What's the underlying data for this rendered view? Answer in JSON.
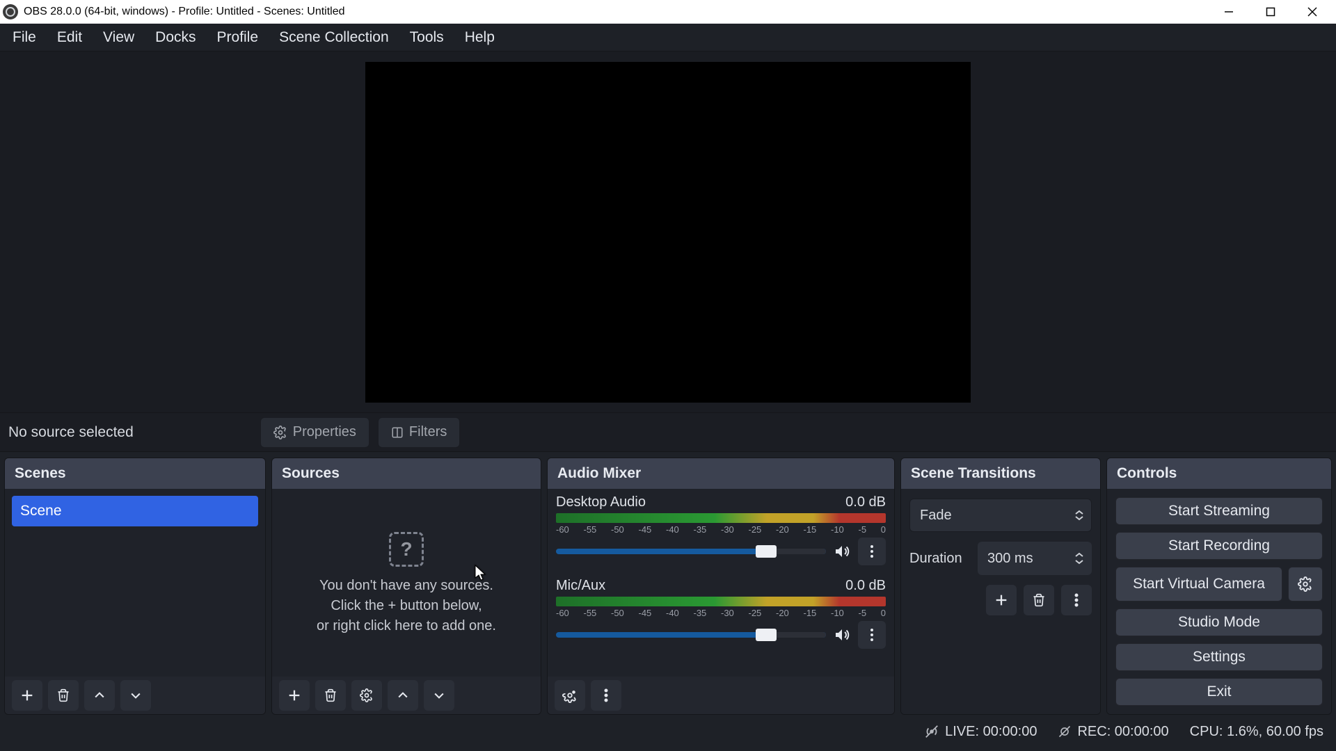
{
  "window": {
    "title": "OBS 28.0.0 (64-bit, windows) - Profile: Untitled - Scenes: Untitled"
  },
  "menu": {
    "items": [
      "File",
      "Edit",
      "View",
      "Docks",
      "Profile",
      "Scene Collection",
      "Tools",
      "Help"
    ]
  },
  "source_toolbar": {
    "status": "No source selected",
    "properties_label": "Properties",
    "filters_label": "Filters"
  },
  "docks": {
    "scenes": {
      "title": "Scenes",
      "items": [
        "Scene"
      ]
    },
    "sources": {
      "title": "Sources",
      "empty_line1": "You don't have any sources.",
      "empty_line2": "Click the + button below,",
      "empty_line3": "or right click here to add one."
    },
    "mixer": {
      "title": "Audio Mixer",
      "ticks": [
        "-60",
        "-55",
        "-50",
        "-45",
        "-40",
        "-35",
        "-30",
        "-25",
        "-20",
        "-15",
        "-10",
        "-5",
        "0"
      ],
      "channels": [
        {
          "name": "Desktop Audio",
          "level": "0.0 dB"
        },
        {
          "name": "Mic/Aux",
          "level": "0.0 dB"
        }
      ]
    },
    "transitions": {
      "title": "Scene Transitions",
      "selected": "Fade",
      "duration_label": "Duration",
      "duration_value": "300 ms"
    },
    "controls": {
      "title": "Controls",
      "start_streaming": "Start Streaming",
      "start_recording": "Start Recording",
      "start_virtual_camera": "Start Virtual Camera",
      "studio_mode": "Studio Mode",
      "settings": "Settings",
      "exit": "Exit"
    }
  },
  "statusbar": {
    "live": "LIVE: 00:00:00",
    "rec": "REC: 00:00:00",
    "cpu": "CPU: 1.6%, 60.00 fps"
  },
  "colors": {
    "accent": "#3063e3",
    "panel": "#23262e",
    "panel_header": "#3c4150",
    "button": "#2b2f38",
    "bg": "#1e2127"
  }
}
